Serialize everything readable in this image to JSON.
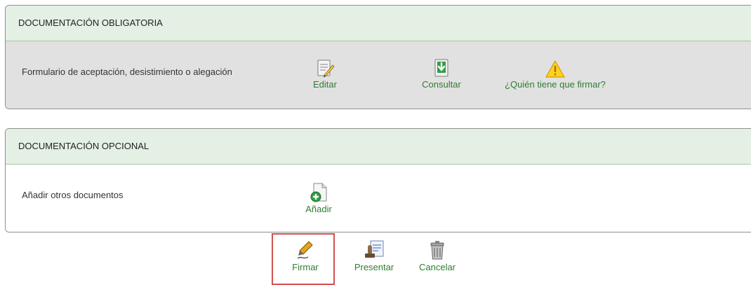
{
  "mandatory": {
    "title": "DOCUMENTACIÓN OBLIGATORIA",
    "row_label": "Formulario de aceptación, desistimiento o alegación",
    "actions": {
      "edit": {
        "label": "Editar",
        "icon": "edit-document-icon"
      },
      "view": {
        "label": "Consultar",
        "icon": "download-document-icon"
      },
      "who_signs": {
        "label": "¿Quién tiene que firmar?",
        "icon": "warning-icon"
      }
    }
  },
  "optional": {
    "title": "DOCUMENTACIÓN OPCIONAL",
    "row_label": "Añadir otros documentos",
    "actions": {
      "add": {
        "label": "Añadir",
        "icon": "add-document-icon"
      }
    }
  },
  "toolbar": {
    "sign": {
      "label": "Firmar",
      "icon": "pen-icon"
    },
    "submit": {
      "label": "Presentar",
      "icon": "stamp-document-icon"
    },
    "cancel": {
      "label": "Cancelar",
      "icon": "trash-can-icon"
    }
  },
  "colors": {
    "header_bg": "#e4f0e4",
    "mandatory_body_bg": "#e1e1e1",
    "link_green": "#2e7d32",
    "highlight_red": "#d45050"
  }
}
